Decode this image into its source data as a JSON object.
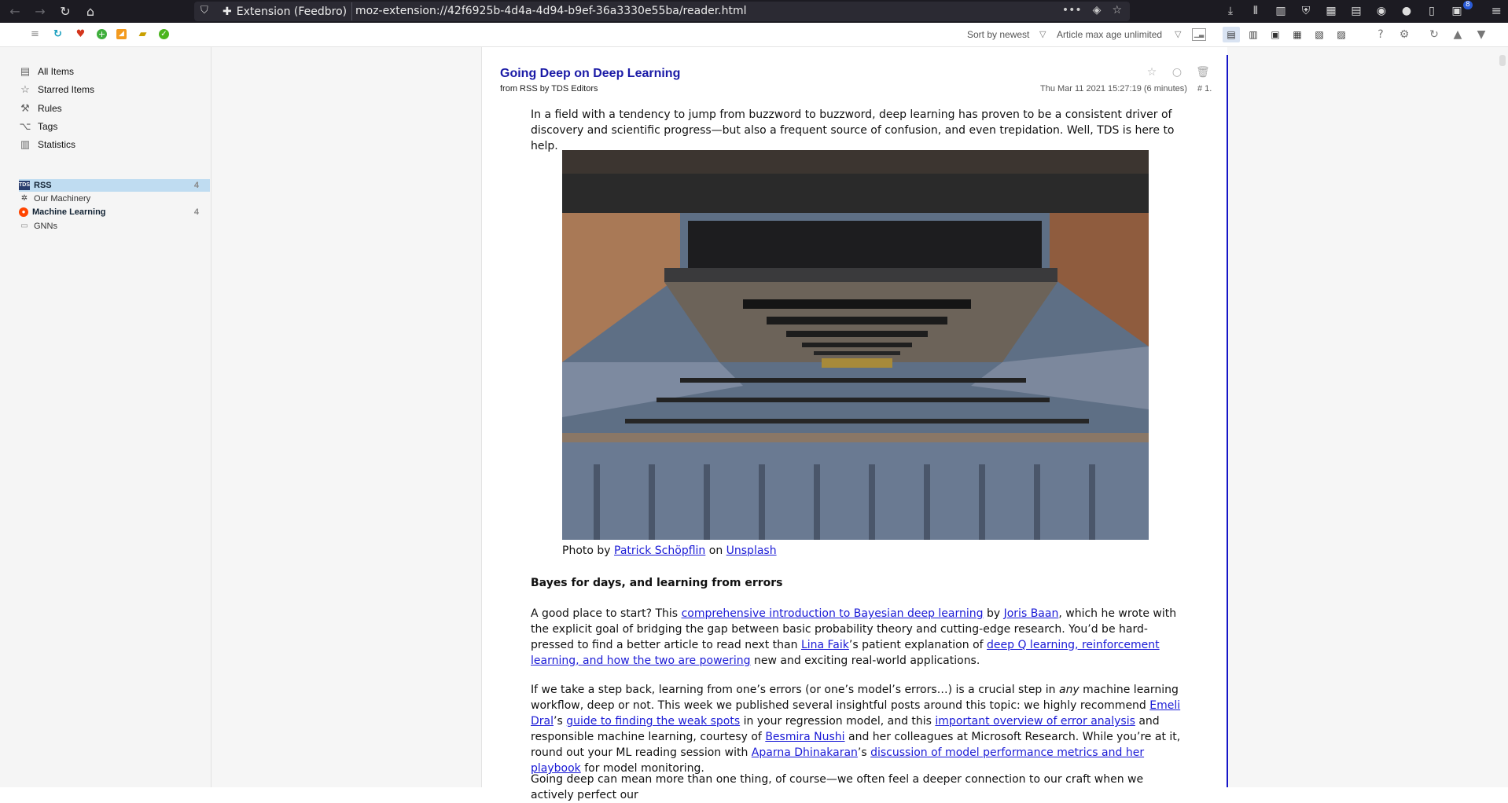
{
  "browser": {
    "extension_label": "Extension (Feedbro)",
    "url": "moz-extension://42f6925b-4d4a-4d94-b9ef-36a3330e55ba/reader.html",
    "badge_count": "8"
  },
  "toolbar": {
    "sort_label": "Sort by newest",
    "max_age_label": "Article max age unlimited"
  },
  "sidebar": {
    "nav": [
      {
        "label": "All Items",
        "icon": "all-items-icon"
      },
      {
        "label": "Starred Items",
        "icon": "star-icon"
      },
      {
        "label": "Rules",
        "icon": "wrench-icon"
      },
      {
        "label": "Tags",
        "icon": "tag-icon"
      },
      {
        "label": "Statistics",
        "icon": "chart-icon"
      }
    ],
    "feeds": [
      {
        "label": "RSS",
        "count": "4"
      },
      {
        "label": "Our Machinery",
        "count": ""
      },
      {
        "label": "Machine Learning",
        "count": "4"
      },
      {
        "label": "GNNs",
        "count": ""
      }
    ]
  },
  "article": {
    "title": "Going Deep on Deep Learning",
    "from": "from RSS by TDS Editors",
    "date": "Thu Mar 11 2021 15:27:19 (6 minutes)",
    "number": "# 1.",
    "intro": "In a field with a tendency to jump from buzzword to buzzword, deep learning has proven to be a consistent driver of discovery and scientific progress—but also a frequent source of confusion, and even trepidation. Well, TDS is here to help.",
    "caption": {
      "prefix": "Photo by ",
      "author": "Patrick Schöpflin",
      "on": " on ",
      "site": "Unsplash"
    },
    "heading1": "Bayes for days, and learning from errors",
    "p1": {
      "t1": "A good place to start? This ",
      "l1": "comprehensive introduction to Bayesian deep learning",
      "t2": " by ",
      "l2": "Joris Baan",
      "t3": ", which he wrote with the explicit goal of bridging the gap between basic probability theory and cutting-edge research. You’d be hard-pressed to find a better article to read next than ",
      "l3": "Lina Faik",
      "t4": "’s patient explanation of ",
      "l4": "deep Q learning, reinforcement learning, and how the two are powering",
      "t5": " new and exciting real-world applications."
    },
    "p2": {
      "t1": "If we take a step back, learning from one’s errors (or one’s model’s errors…) is a crucial step in ",
      "em": "any",
      "t2": " machine learning workflow, deep or not. This week we published several insightful posts around this topic: we highly recommend ",
      "l1": "Emeli Dral",
      "t3": "’s ",
      "l2": "guide to finding the weak spots",
      "t4": " in your regression model, and this ",
      "l3": "important overview of error analysis",
      "t5": " and responsible machine learning, courtesy of ",
      "l4": "Besmira Nushi",
      "t6": " and her colleagues at Microsoft Research. While you’re at it, round out your ML reading session with ",
      "l5": "Aparna Dhinakaran",
      "t7": "’s ",
      "l6": "discussion of model performance metrics and her playbook",
      "t8": " for model monitoring."
    },
    "p3": "Going deep can mean more than one thing, of course—we often feel a deeper connection to our craft when we actively perfect our"
  }
}
